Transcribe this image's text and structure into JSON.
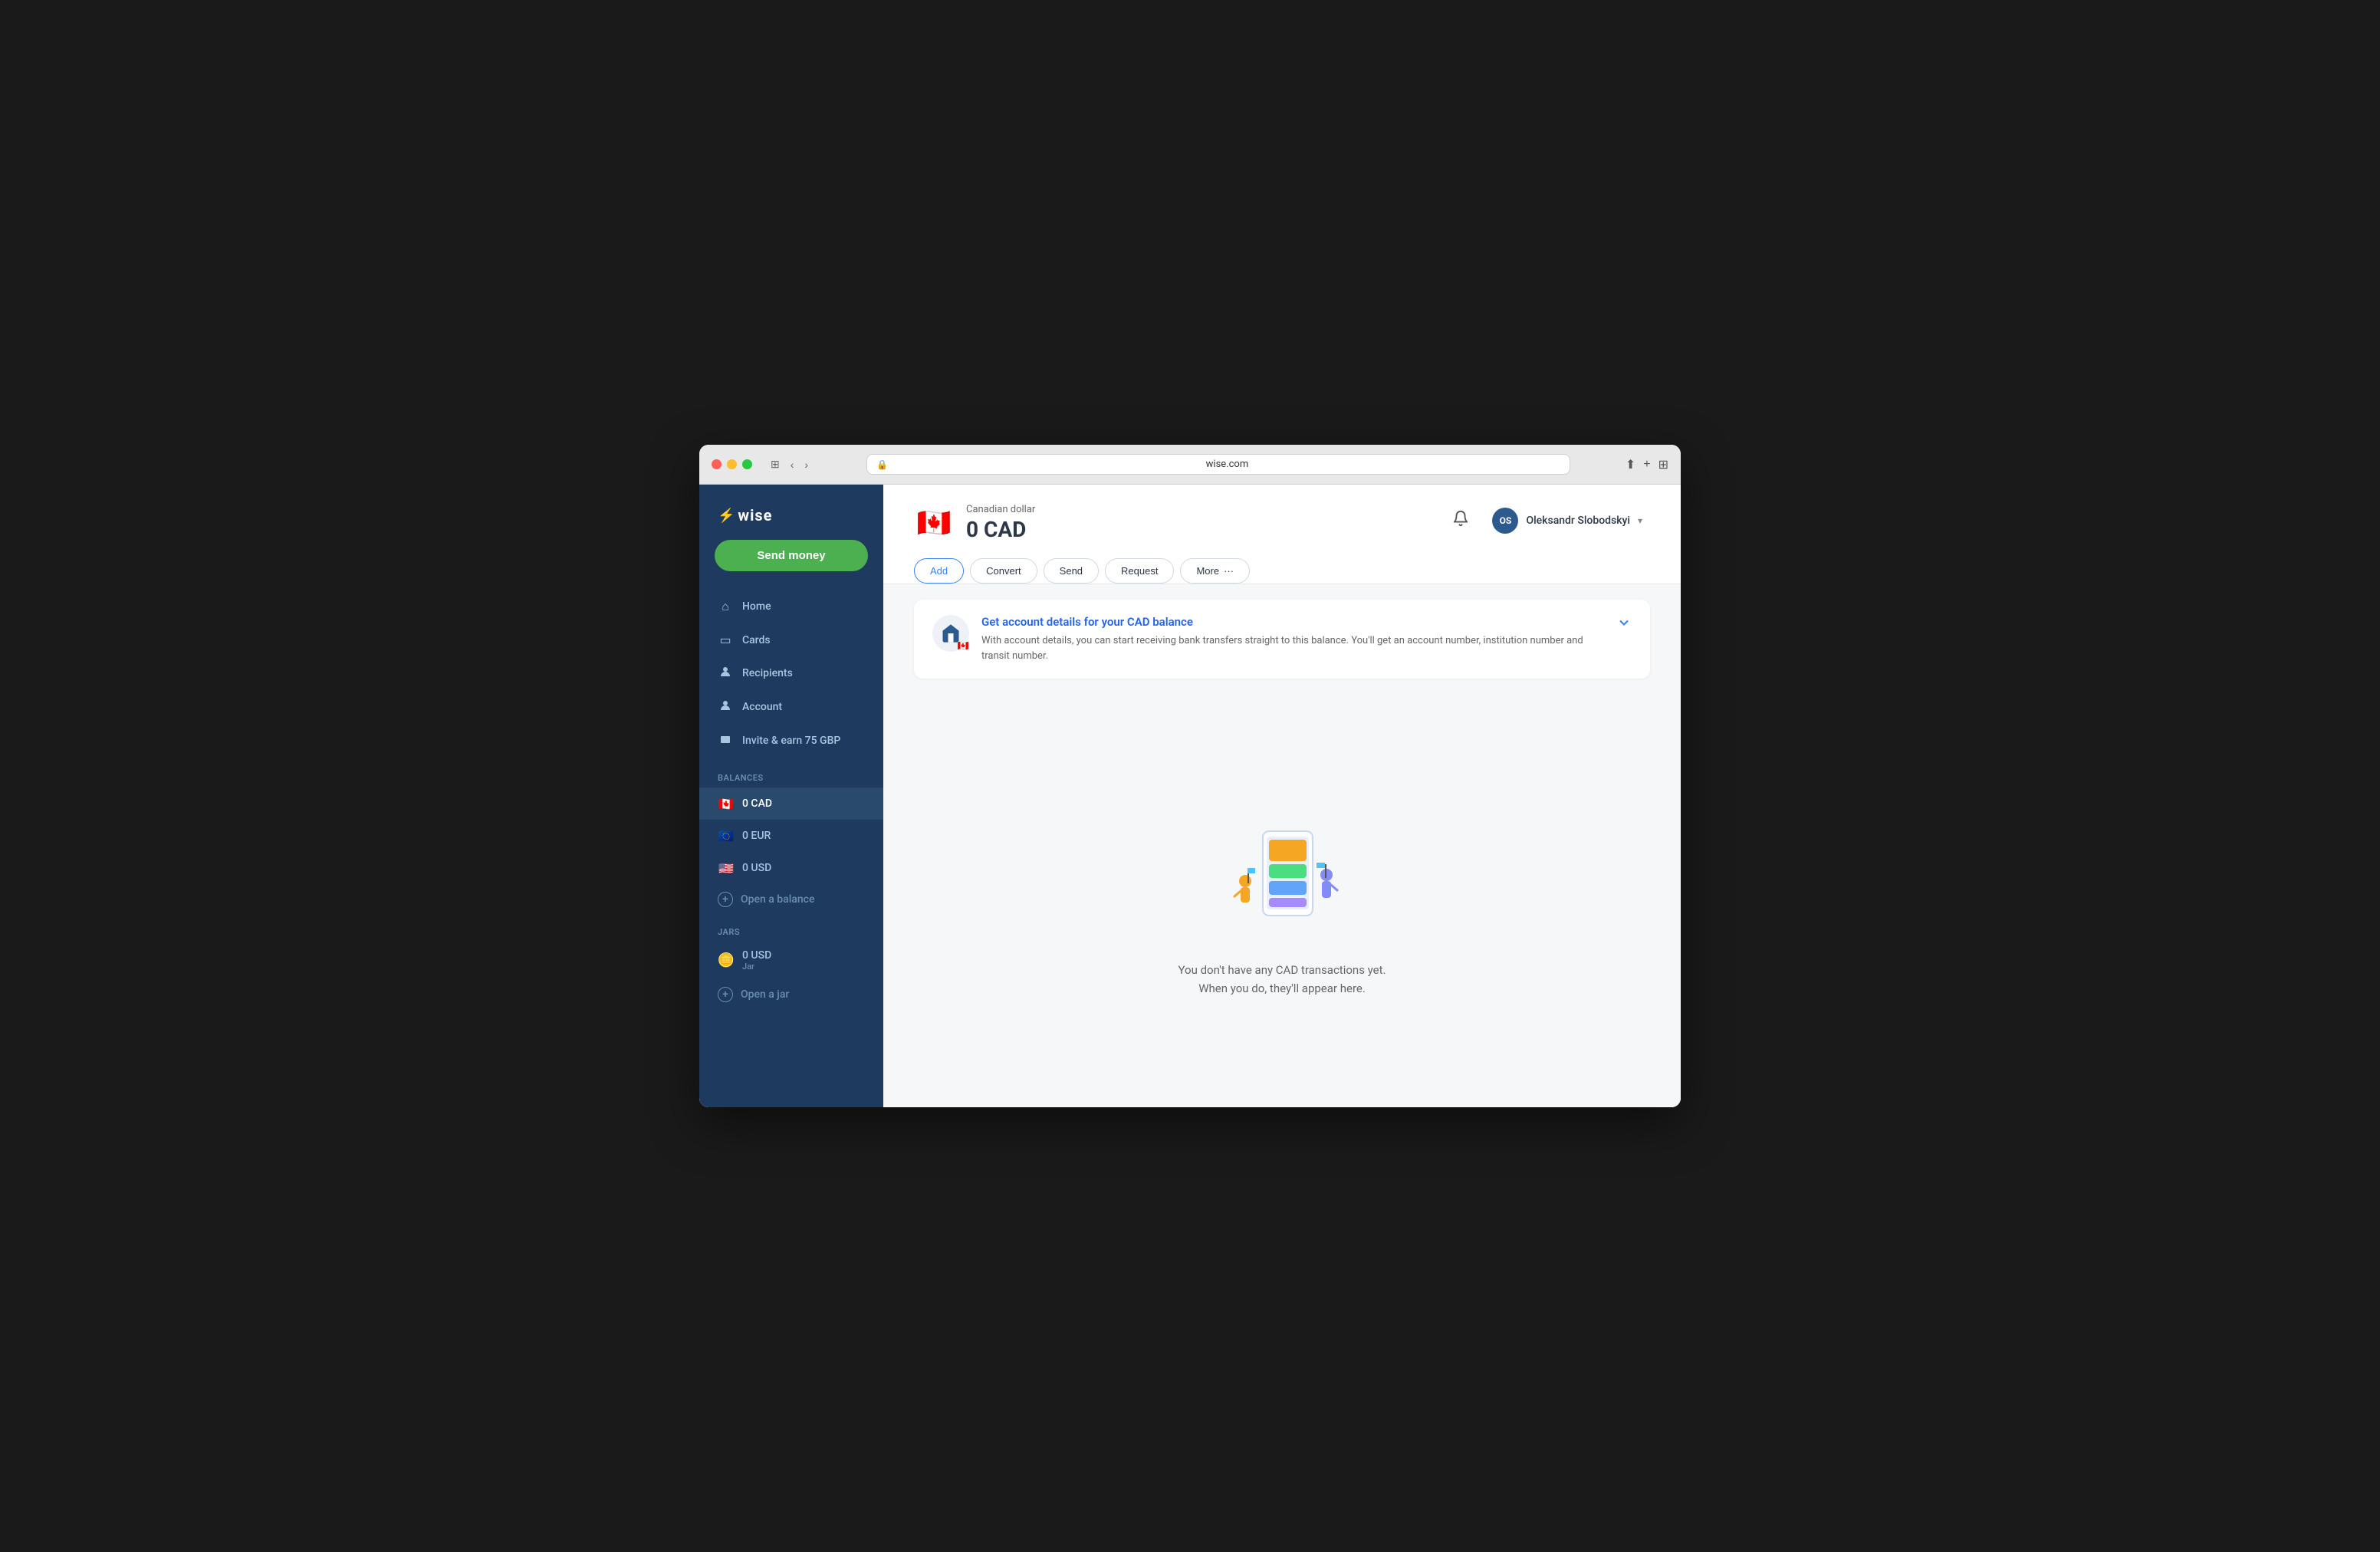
{
  "browser": {
    "url": "wise.com",
    "tab_icon": "🛡️"
  },
  "sidebar": {
    "logo_text": "wise",
    "send_money_label": "Send money",
    "nav_items": [
      {
        "id": "home",
        "label": "Home",
        "icon": "⌂"
      },
      {
        "id": "cards",
        "label": "Cards",
        "icon": "▭"
      },
      {
        "id": "recipients",
        "label": "Recipients",
        "icon": "👤"
      },
      {
        "id": "account",
        "label": "Account",
        "icon": "👤"
      },
      {
        "id": "invite",
        "label": "Invite & earn 75 GBP",
        "icon": "🎁"
      }
    ],
    "balances_label": "Balances",
    "balances": [
      {
        "id": "cad",
        "currency": "CAD",
        "amount": "0 CAD",
        "flag": "🇨🇦",
        "active": true
      },
      {
        "id": "eur",
        "currency": "EUR",
        "amount": "0 EUR",
        "flag": "🇪🇺"
      },
      {
        "id": "usd",
        "currency": "USD",
        "amount": "0 USD",
        "flag": "🇺🇸"
      }
    ],
    "open_balance_label": "Open a balance",
    "jars_label": "Jars",
    "jars": [
      {
        "id": "jar-usd",
        "currency": "USD",
        "amount": "0 USD",
        "sub": "Jar",
        "icon": "🪙"
      }
    ],
    "open_jar_label": "Open a jar"
  },
  "header": {
    "currency_name": "Canadian dollar",
    "currency_code": "CAD",
    "balance": "0 CAD",
    "flag": "🇨🇦",
    "notification_icon": "🔔",
    "user_initials": "OS",
    "user_name": "Oleksandr Slobodskyi"
  },
  "action_buttons": [
    {
      "id": "add",
      "label": "Add",
      "primary": true
    },
    {
      "id": "convert",
      "label": "Convert",
      "primary": false
    },
    {
      "id": "send",
      "label": "Send",
      "primary": false
    },
    {
      "id": "request",
      "label": "Request",
      "primary": false
    },
    {
      "id": "more",
      "label": "More",
      "primary": false,
      "has_dots": true
    }
  ],
  "info_card": {
    "title": "Get account details for your CAD balance",
    "description": "With account details, you can start receiving bank transfers straight to this balance. You'll get an account number, institution number and transit number.",
    "bank_icon": "🏦",
    "flag": "🇨🇦"
  },
  "empty_state": {
    "line1": "You don't have any CAD transactions yet.",
    "line2": "When you do, they'll appear here."
  }
}
